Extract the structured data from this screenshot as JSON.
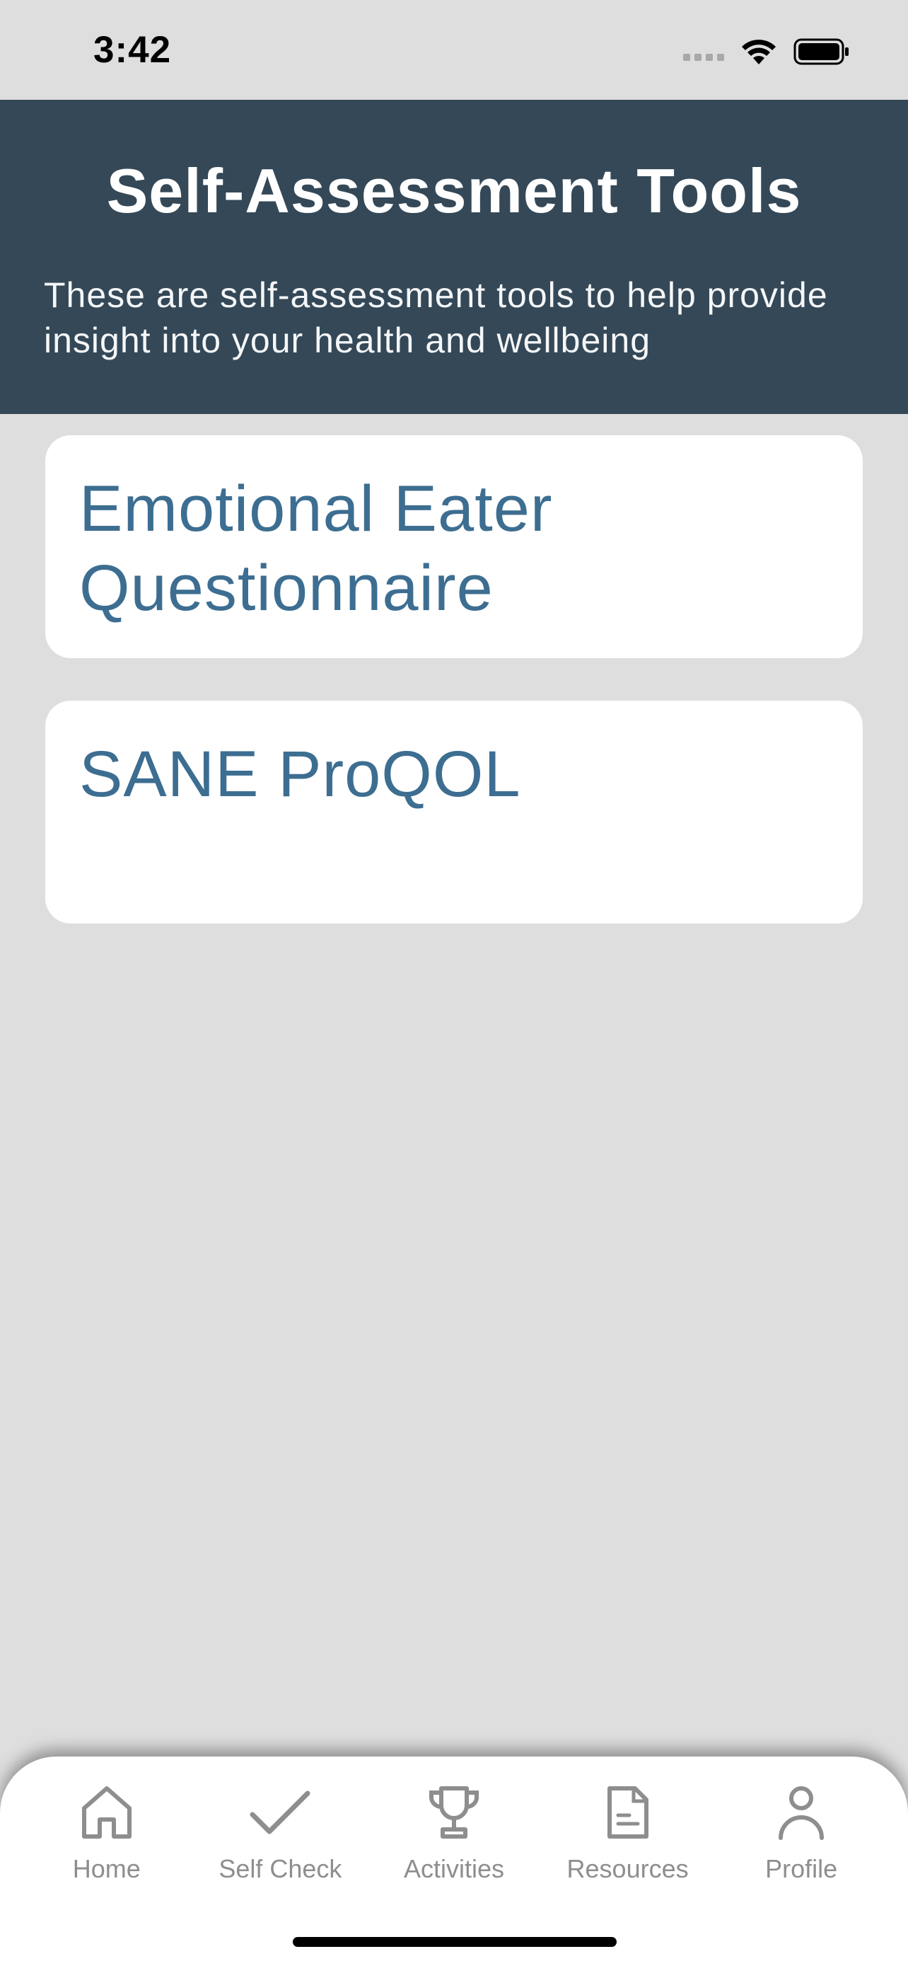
{
  "status_bar": {
    "time": "3:42",
    "icons": [
      "cellular-signal-icon",
      "wifi-icon",
      "battery-icon"
    ]
  },
  "header": {
    "title": "Self-Assessment Tools",
    "subtitle": "These are self-assessment tools to help provide insight into your health and wellbeing"
  },
  "tools": [
    {
      "title": "Emotional Eater Questionnaire"
    },
    {
      "title": "SANE ProQOL"
    }
  ],
  "tab_bar": {
    "tabs": [
      {
        "label": "Home",
        "icon": "home-icon"
      },
      {
        "label": "Self Check",
        "icon": "checkmark-icon"
      },
      {
        "label": "Activities",
        "icon": "trophy-icon"
      },
      {
        "label": "Resources",
        "icon": "document-icon"
      },
      {
        "label": "Profile",
        "icon": "person-icon"
      }
    ]
  },
  "colors": {
    "header_bg": "#344857",
    "card_title": "#3d6e91",
    "page_bg": "#dedede",
    "tab_icon": "#8e8e8e"
  }
}
